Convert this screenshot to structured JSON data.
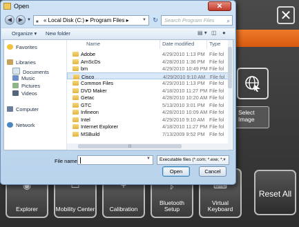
{
  "dialog": {
    "title": "Open",
    "close_glyph": "✕",
    "address": {
      "path": "« Local Disk (C:) ▸ Program Files ▸"
    },
    "search_placeholder": "Search Program Files",
    "toolbar": {
      "organize": "Organize ▾",
      "new_folder": "New folder"
    },
    "nav": {
      "favorites": "Favorites",
      "libraries": "Libraries",
      "library_items": [
        "Documents",
        "Music",
        "Pictures",
        "Videos"
      ],
      "computer": "Computer",
      "network": "Network"
    },
    "columns": {
      "name": "Name",
      "date": "Date modified",
      "type": "Type"
    },
    "files": [
      {
        "name": "Adobe",
        "date": "4/29/2010 1:13 PM",
        "type": "File fol"
      },
      {
        "name": "AmScDs",
        "date": "4/28/2010 1:36 PM",
        "type": "File fol"
      },
      {
        "name": "bm",
        "date": "4/29/2010 10:49 PM",
        "type": "File fol"
      },
      {
        "name": "Cisco",
        "date": "4/29/2010 9:10 AM",
        "type": "File fol"
      },
      {
        "name": "Common Files",
        "date": "4/29/2010 1:13 PM",
        "type": "File fol"
      },
      {
        "name": "DVD Maker",
        "date": "4/18/2010 11:27 PM",
        "type": "File fol"
      },
      {
        "name": "Getac",
        "date": "4/28/2010 10:20 AM",
        "type": "File fol"
      },
      {
        "name": "GTC",
        "date": "5/13/2010 3:01 PM",
        "type": "File fol"
      },
      {
        "name": "Infineon",
        "date": "4/28/2010 10:09 AM",
        "type": "File fol"
      },
      {
        "name": "Intel",
        "date": "4/29/2010 9:10 AM",
        "type": "File fol"
      },
      {
        "name": "Internet Explorer",
        "date": "4/18/2010 11:27 PM",
        "type": "File fol"
      },
      {
        "name": "MSBuild",
        "date": "7/13/2009 9:52 PM",
        "type": "File fol"
      }
    ],
    "selected_index": 3,
    "file_name_label": "File name:",
    "file_name_value": "",
    "filter": "Executable files (*.com; *.exe; *.",
    "open_button": "Open",
    "cancel_button": "Cancel"
  },
  "launcher": {
    "close_glyph": "✕",
    "select_image": "Select Image",
    "tiles": [
      {
        "label": "Explorer",
        "icon": "globe-cursor-icon",
        "glyph": "◉"
      },
      {
        "label": "Mobility Center",
        "icon": "monitor-icon",
        "glyph": "▭"
      },
      {
        "label": "Calibration",
        "icon": "crosshair-icon",
        "glyph": "+"
      },
      {
        "label": "Bluetooth Setup",
        "icon": "bluetooth-icon",
        "glyph": "ᛒ"
      },
      {
        "label": "Virtual Keyboard",
        "icon": "keyboard-icon",
        "glyph": "⌨"
      }
    ],
    "reset_all": "Reset All"
  },
  "colors": {
    "accent_orange": "#e8691d",
    "dialog_frame": "#b9d3ec",
    "selected_row": "#d8e8f9"
  }
}
